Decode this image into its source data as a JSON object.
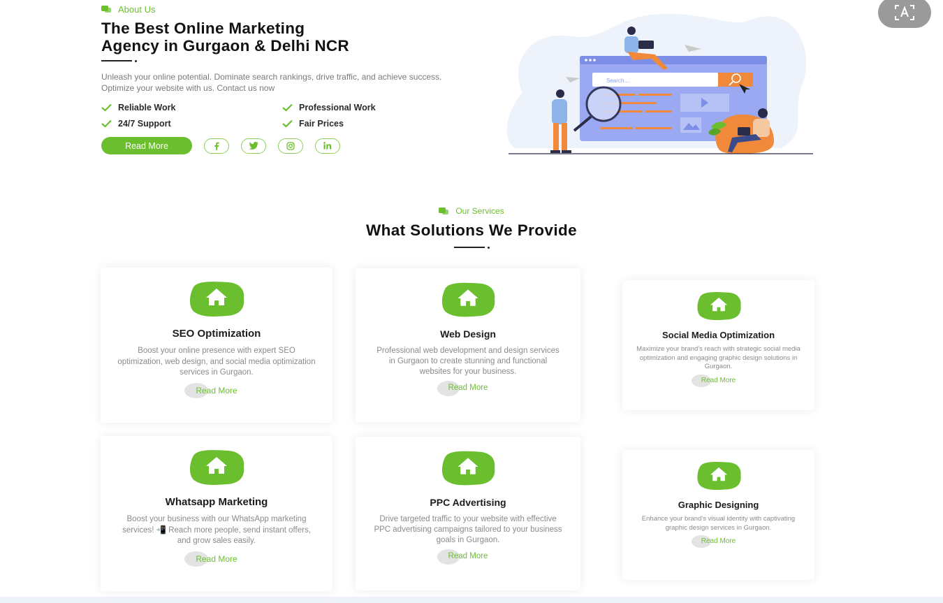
{
  "about": {
    "tag": "About Us",
    "title_line1": "The Best Online Marketing",
    "title_line2": "Agency in Gurgaon & Delhi NCR",
    "lead": "Unleash your online potential. Dominate search rankings, drive traffic, and achieve success. Optimize your website with us. Contact us now",
    "features": [
      "Reliable Work",
      "Professional Work",
      "24/7 Support",
      "Fair Prices"
    ],
    "cta": "Read More",
    "social": [
      "facebook-icon",
      "twitter-icon",
      "instagram-icon",
      "linkedin-icon"
    ]
  },
  "illustration": {
    "search_placeholder": "Search...."
  },
  "services": {
    "tag": "Our Services",
    "title": "What Solutions We Provide",
    "cards": [
      {
        "title": "SEO Optimization",
        "desc": "Boost your online presence with expert SEO optimization, web design, and social media optimization services in Gurgaon.",
        "link": "Read More"
      },
      {
        "title": "Web Design",
        "desc": "Professional web development and design services in Gurgaon to create stunning and functional websites for your business.",
        "link": "Read More"
      },
      {
        "title": "Social Media Optimization",
        "desc": "Maximize your brand's reach with strategic social media optimization and engaging graphic design solutions in Gurgaon.",
        "link": "Read More"
      },
      {
        "title": "Whatsapp Marketing",
        "desc": "Boost your business with our WhatsApp marketing services! 📲 Reach more people, send instant offers, and grow sales easily.",
        "link": "Read More"
      },
      {
        "title": "PPC Advertising",
        "desc": "Drive targeted traffic to your website with effective PPC advertising campaigns tailored to your business goals in Gurgaon.",
        "link": "Read More"
      },
      {
        "title": "Graphic Designing",
        "desc": "Enhance your brand's visual identity with captivating graphic design services in Gurgaon.",
        "link": "Read More"
      }
    ]
  },
  "colors": {
    "accent": "#6bbf2f",
    "illus_blue": "#8c9ef0",
    "illus_orange": "#f08a3a"
  },
  "corner_button_icon": "text-recognition-icon"
}
